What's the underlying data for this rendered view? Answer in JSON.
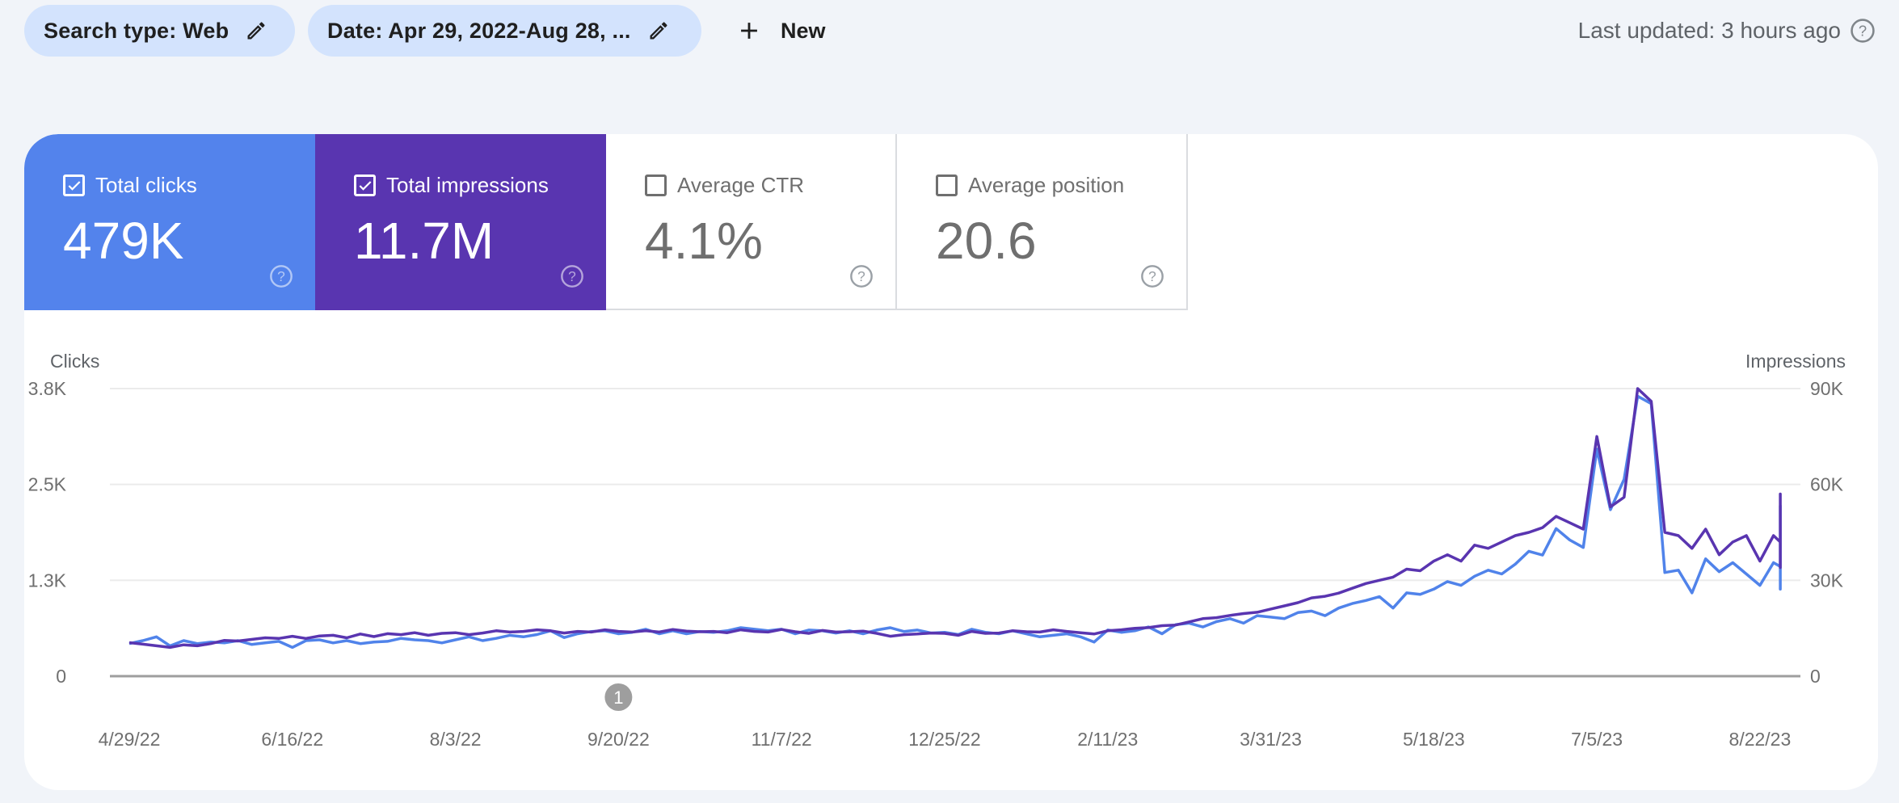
{
  "filters": {
    "search_type": "Search type: Web",
    "date": "Date: Apr 29, 2022-Aug 28, ...",
    "new_label": "New"
  },
  "last_updated": "Last updated: 3 hours ago",
  "metrics": [
    {
      "label": "Total clicks",
      "value": "479K",
      "checked": true,
      "color": "#5383ec"
    },
    {
      "label": "Total impressions",
      "value": "11.7M",
      "checked": true,
      "color": "#5935b0"
    },
    {
      "label": "Average CTR",
      "value": "4.1%",
      "checked": false
    },
    {
      "label": "Average position",
      "value": "20.6",
      "checked": false
    }
  ],
  "annotation": {
    "label": "1",
    "date": "9/20/22"
  },
  "chart_data": {
    "type": "line",
    "title": "",
    "xlabel": "",
    "ylabel": "Clicks",
    "ylabel_right": "Impressions",
    "x_start": "2022-04-29",
    "x_end": "2023-08-28",
    "x_step_days": 4,
    "x_tick_labels": [
      "4/29/22",
      "6/16/22",
      "8/3/22",
      "9/20/22",
      "11/7/22",
      "12/25/22",
      "2/11/23",
      "3/31/23",
      "5/18/23",
      "7/5/23",
      "8/22/23"
    ],
    "y_left_ticks": [
      "0",
      "1.3K",
      "2.5K",
      "3.8K"
    ],
    "y_left_range": [
      0,
      3800
    ],
    "y_right_ticks": [
      "0",
      "30K",
      "60K",
      "90K"
    ],
    "y_right_range": [
      0,
      90000
    ],
    "grid": true,
    "legend": "none",
    "series": [
      {
        "name": "Clicks",
        "axis": "left",
        "color": "#5083ea",
        "values": [
          430,
          470,
          520,
          400,
          470,
          430,
          450,
          440,
          470,
          420,
          440,
          460,
          380,
          470,
          480,
          440,
          470,
          430,
          450,
          460,
          500,
          480,
          470,
          440,
          480,
          520,
          470,
          500,
          540,
          520,
          550,
          600,
          510,
          560,
          590,
          600,
          560,
          580,
          620,
          560,
          600,
          560,
          590,
          580,
          600,
          640,
          620,
          600,
          620,
          560,
          610,
          600,
          570,
          600,
          560,
          610,
          640,
          590,
          610,
          570,
          580,
          550,
          620,
          580,
          560,
          600,
          560,
          520,
          540,
          560,
          520,
          450,
          610,
          580,
          600,
          650,
          560,
          680,
          700,
          650,
          720,
          760,
          700,
          800,
          780,
          760,
          840,
          860,
          800,
          900,
          960,
          1000,
          1050,
          900,
          1100,
          1080,
          1150,
          1250,
          1200,
          1320,
          1400,
          1350,
          1480,
          1650,
          1600,
          1950,
          1800,
          1700,
          3000,
          2200,
          2600,
          3700,
          3600,
          1370,
          1400,
          1100,
          1550,
          1380,
          1500,
          1350,
          1200,
          1500,
          1450,
          1300,
          1600,
          1500,
          1400,
          1700,
          2250,
          2100,
          1750,
          1350,
          1250,
          1300,
          1150,
          1200,
          1450,
          1200,
          1350,
          1400,
          1200,
          1400,
          1350,
          1500,
          1650,
          1300,
          1500,
          1200,
          1550,
          1650,
          1500,
          1700,
          1450,
          1700,
          1600,
          1300,
          1800,
          1550,
          1750,
          1750,
          1500,
          1800,
          1700,
          1650,
          1450,
          1850,
          1900,
          1750,
          1550,
          2050,
          1850,
          1950,
          1700,
          2000,
          2050,
          1700,
          1900
        ]
      },
      {
        "name": "Impressions",
        "axis": "right",
        "color": "#5935b0",
        "values": [
          10500,
          10000,
          9500,
          9000,
          9800,
          9500,
          10200,
          11200,
          11000,
          11500,
          12000,
          11800,
          12500,
          11800,
          12600,
          12800,
          12000,
          13200,
          12400,
          13300,
          13000,
          13600,
          12800,
          13400,
          13600,
          13000,
          13500,
          14200,
          13800,
          14000,
          14500,
          14200,
          13500,
          14000,
          13800,
          14500,
          14000,
          13800,
          14200,
          13800,
          14600,
          14100,
          13900,
          14000,
          13600,
          14500,
          14000,
          13800,
          14600,
          13900,
          13400,
          14300,
          13800,
          13900,
          14100,
          13400,
          12500,
          13000,
          13200,
          13500,
          13400,
          12800,
          14000,
          13400,
          13500,
          14200,
          13900,
          13800,
          14500,
          14000,
          13600,
          13200,
          14200,
          14500,
          15000,
          15200,
          15800,
          16000,
          17000,
          18000,
          18300,
          19000,
          19600,
          20000,
          21000,
          22000,
          23000,
          24500,
          25000,
          26000,
          27500,
          29000,
          30000,
          31000,
          33500,
          33000,
          36000,
          38000,
          36000,
          41000,
          40000,
          42000,
          44000,
          45000,
          46500,
          50000,
          48000,
          46000,
          75000,
          53000,
          56000,
          90000,
          86000,
          45000,
          44000,
          40000,
          46000,
          38000,
          42000,
          44000,
          36000,
          44000,
          42000,
          40000,
          48000,
          45000,
          43000,
          50000,
          55000,
          56000,
          44000,
          40000,
          38000,
          36000,
          34000,
          37000,
          40000,
          38000,
          40000,
          41000,
          38500,
          45000,
          40000,
          46000,
          50000,
          41000,
          42000,
          44000,
          44000,
          42000,
          48000,
          49000,
          42000,
          50000,
          44000,
          46000,
          47000,
          38000,
          48000,
          44000,
          50000,
          50000,
          44000,
          50000,
          47000,
          46000,
          44000,
          53000,
          48000,
          52000,
          46000,
          57000,
          48000,
          49000,
          47000,
          57000,
          46500
        ]
      }
    ]
  }
}
